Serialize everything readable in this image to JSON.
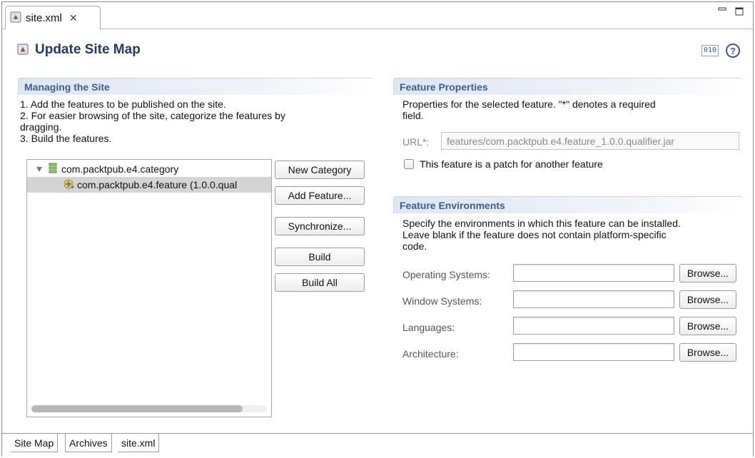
{
  "editor_tab": {
    "label": "site.xml",
    "close_glyph": "✕"
  },
  "header": {
    "title": "Update Site Map"
  },
  "managing": {
    "title": "Managing the Site",
    "lines": [
      "1. Add the features to be published on the site.",
      "2. For easier browsing of the site, categorize the features by",
      "dragging.",
      "3. Build the features."
    ],
    "tree": [
      {
        "label": "com.packtpub.e4.category",
        "expanded": true,
        "icon": "category-icon"
      },
      {
        "label": "com.packtpub.e4.feature (1.0.0.qual",
        "selected": true,
        "icon": "feature-icon"
      }
    ],
    "buttons": {
      "new_category": "New Category",
      "add_feature": "Add Feature...",
      "synchronize": "Synchronize...",
      "build": "Build",
      "build_all": "Build All"
    }
  },
  "properties": {
    "title": "Feature Properties",
    "desc_1": "Properties for the selected feature.  \"*\" denotes a required",
    "desc_2": "field.",
    "url_label": "URL*:",
    "url_value": "features/com.packtpub.e4.feature_1.0.0.qualifier.jar",
    "patch_label": "This feature is a patch for another feature",
    "patch_checked": false
  },
  "environments": {
    "title": "Feature Environments",
    "desc_1": "Specify the environments in which this feature can be installed.",
    "desc_2": "Leave blank if the feature does not contain platform-specific",
    "desc_3": "code.",
    "rows": [
      {
        "label": "Operating Systems:",
        "value": "",
        "browse": "Browse..."
      },
      {
        "label": "Window Systems:",
        "value": "",
        "browse": "Browse..."
      },
      {
        "label": "Languages:",
        "value": "",
        "browse": "Browse..."
      },
      {
        "label": "Architecture:",
        "value": "",
        "browse": "Browse..."
      }
    ]
  },
  "bottom_tabs": [
    "Site Map",
    "Archives",
    "site.xml"
  ],
  "colors": {
    "section_title": "#3e5f8a",
    "selection": "#d4d4d4",
    "page_title": "#243a5e"
  }
}
